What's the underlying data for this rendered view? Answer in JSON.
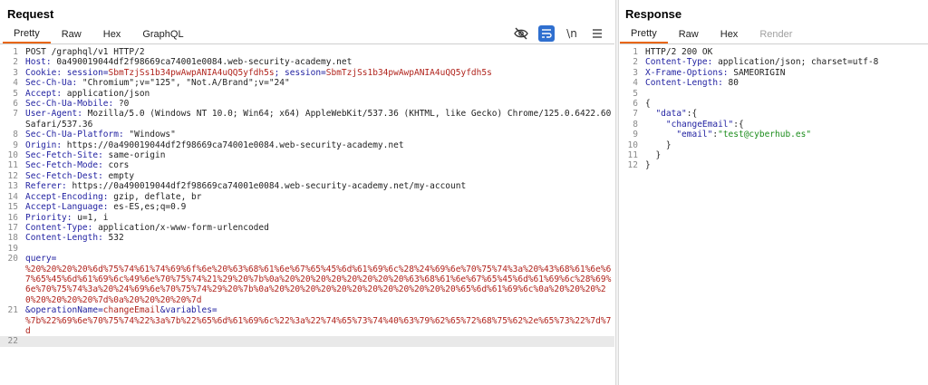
{
  "request": {
    "title": "Request",
    "tabs": [
      "Pretty",
      "Raw",
      "Hex",
      "GraphQL"
    ],
    "active_tab": "Pretty",
    "tools": [
      "eye-slash-icon",
      "wrap-icon",
      "newline-icon",
      "menu-icon"
    ],
    "tool_newline_label": "\\n",
    "line_numbers": [
      "1",
      "2",
      "3",
      "4",
      "5",
      "6",
      "7",
      "8",
      "9",
      "10",
      "11",
      "12",
      "13",
      "14",
      "15",
      "16",
      "17",
      "18",
      "19",
      "20",
      "21",
      "22"
    ],
    "lines": {
      "l1": "POST /graphql/v1 HTTP/2",
      "l2_k": "Host:",
      "l2_v": " 0a490019044df2f98669ca74001e0084.web-security-academy.net",
      "l3_k": "Cookie:",
      "l3_a": " session=",
      "l3_b": "SbmTzjSs1b34pwAwpANIA4uQQ5yfdh5s",
      "l3_c": "; session=",
      "l3_d": "SbmTzjSs1b34pwAwpANIA4uQQ5yfdh5s",
      "l4_k": "Sec-Ch-Ua:",
      "l4_v": " \"Chromium\";v=\"125\", \"Not.A/Brand\";v=\"24\"",
      "l5_k": "Accept:",
      "l5_v": " application/json",
      "l6_k": "Sec-Ch-Ua-Mobile:",
      "l6_v": " ?0",
      "l7_k": "User-Agent:",
      "l7_v": " Mozilla/5.0 (Windows NT 10.0; Win64; x64) AppleWebKit/537.36 (KHTML, like Gecko) Chrome/125.0.6422.60 Safari/537.36",
      "l8_k": "Sec-Ch-Ua-Platform:",
      "l8_v": " \"Windows\"",
      "l9_k": "Origin:",
      "l9_v": " https://0a490019044df2f98669ca74001e0084.web-security-academy.net",
      "l10_k": "Sec-Fetch-Site:",
      "l10_v": " same-origin",
      "l11_k": "Sec-Fetch-Mode:",
      "l11_v": " cors",
      "l12_k": "Sec-Fetch-Dest:",
      "l12_v": " empty",
      "l13_k": "Referer:",
      "l13_v": " https://0a490019044df2f98669ca74001e0084.web-security-academy.net/my-account",
      "l14_k": "Accept-Encoding:",
      "l14_v": " gzip, deflate, br",
      "l15_k": "Accept-Language:",
      "l15_v": " es-ES,es;q=0.9",
      "l16_k": "Priority:",
      "l16_v": " u=1, i",
      "l17_k": "Content-Type:",
      "l17_v": " application/x-www-form-urlencoded",
      "l18_k": "Content-Length:",
      "l18_v": " 532",
      "l20_k": "query=",
      "l20_v": "%20%20%20%20%6d%75%74%61%74%69%6f%6e%20%63%68%61%6e%67%65%45%6d%61%69%6c%28%24%69%6e%70%75%74%3a%20%43%68%61%6e%67%65%45%6d%61%69%6c%49%6e%70%75%74%21%29%20%7b%0a%20%20%20%20%20%20%20%20%63%68%61%6e%67%65%45%6d%61%69%6c%28%69%6e%70%75%74%3a%20%24%69%6e%70%75%74%29%20%7b%0a%20%20%20%20%20%20%20%20%20%20%20%20%65%6d%61%69%6c%0a%20%20%20%20%20%20%20%20%7d%0a%20%20%20%20%7d",
      "l21_k": "&operationName=",
      "l21_a": "changeEmail",
      "l21_b": "&variables=",
      "l21_c": "%7b%22%69%6e%70%75%74%22%3a%7b%22%65%6d%61%69%6c%22%3a%22%74%65%73%74%40%63%79%62%65%72%68%75%62%2e%65%73%22%7d%7d"
    }
  },
  "response": {
    "title": "Response",
    "tabs": [
      "Pretty",
      "Raw",
      "Hex",
      "Render"
    ],
    "active_tab": "Pretty",
    "line_numbers": [
      "1",
      "2",
      "3",
      "4",
      "5",
      "6",
      "7",
      "8",
      "9",
      "10",
      "11",
      "12"
    ],
    "lines": {
      "l1": "HTTP/2 200 OK",
      "l2_k": "Content-Type:",
      "l2_v": " application/json; charset=utf-8",
      "l3_k": "X-Frame-Options:",
      "l3_v": " SAMEORIGIN",
      "l4_k": "Content-Length:",
      "l4_v": " 80",
      "l6": "{",
      "l7_k": "\"data\"",
      "l7_v": ":{",
      "l8_k": "\"changeEmail\"",
      "l8_v": ":{",
      "l9_k": "\"email\"",
      "l9_c": ":",
      "l9_v": "\"test@cyberhub.es\"",
      "l10": "}",
      "l11": "}",
      "l12": "}"
    }
  },
  "colors": {
    "accent": "#e8660c",
    "header_key": "#1f1fa0",
    "value_red": "#b0231c",
    "string_green": "#1a8c1a",
    "toggle_blue": "#2f6fcf"
  }
}
